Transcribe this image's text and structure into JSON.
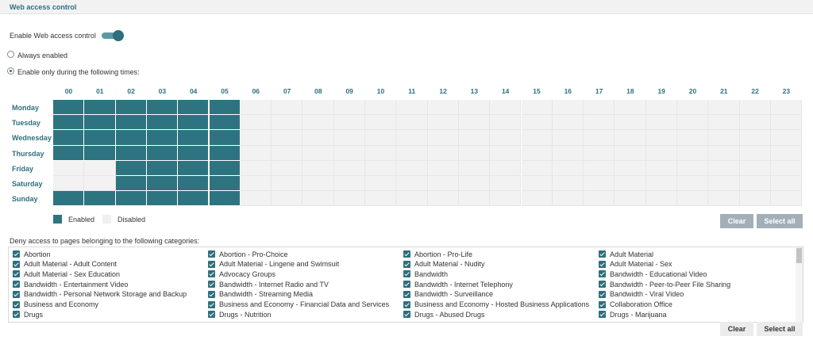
{
  "panel": {
    "title": "Web access control"
  },
  "enable": {
    "label": "Enable Web access control",
    "on": true
  },
  "schedule_mode": {
    "always_label": "Always enabled",
    "times_label": "Enable only during the following times:",
    "selected": "times"
  },
  "schedule": {
    "hours": [
      "00",
      "01",
      "02",
      "03",
      "04",
      "05",
      "06",
      "07",
      "08",
      "09",
      "10",
      "11",
      "12",
      "13",
      "14",
      "15",
      "16",
      "17",
      "18",
      "19",
      "20",
      "21",
      "22",
      "23"
    ],
    "days": [
      {
        "label": "Monday",
        "enabled_hours": [
          0,
          1,
          2,
          3,
          4,
          5
        ]
      },
      {
        "label": "Tuesday",
        "enabled_hours": [
          0,
          1,
          2,
          3,
          4,
          5
        ]
      },
      {
        "label": "Wednesday",
        "enabled_hours": [
          0,
          1,
          2,
          3,
          4,
          5
        ]
      },
      {
        "label": "Thursday",
        "enabled_hours": [
          0,
          1,
          2,
          3,
          4,
          5
        ]
      },
      {
        "label": "Friday",
        "enabled_hours": [
          2,
          3,
          4,
          5
        ]
      },
      {
        "label": "Saturday",
        "enabled_hours": [
          2,
          3,
          4,
          5
        ]
      },
      {
        "label": "Sunday",
        "enabled_hours": [
          0,
          1,
          2,
          3,
          4,
          5
        ]
      }
    ],
    "legend": {
      "enabled": "Enabled",
      "disabled": "Disabled"
    },
    "clear_label": "Clear",
    "select_all_label": "Select all"
  },
  "categories": {
    "heading": "Deny access to pages belonging to the following categories:",
    "columns": [
      [
        "Abortion",
        "Adult Material - Adult Content",
        "Adult Material - Sex Education",
        "Bandwidth - Entertainment Video",
        "Bandwidth - Personal Network Storage and Backup",
        "Business and Economy",
        "Drugs"
      ],
      [
        "Abortion - Pro-Choice",
        "Adult Material - Lingerie and Swimsuit",
        "Advocacy Groups",
        "Bandwidth - Internet Radio and TV",
        "Bandwidth - Streaming Media",
        "Business and Economy - Financial Data and Services",
        "Drugs - Nutrition"
      ],
      [
        "Abortion - Pro-Life",
        "Adult Material - Nudity",
        "Bandwidth",
        "Bandwidth - Internet Telephony",
        "Bandwidth - Surveillance",
        "Business and Economy - Hosted Business Applications",
        "Drugs - Abused Drugs"
      ],
      [
        "Adult Material",
        "Adult Material - Sex",
        "Bandwidth - Educational Video",
        "Bandwidth - Peer-to-Peer File Sharing",
        "Bandwidth - Viral Video",
        "Collaboration Office",
        "Drugs - Marijuana"
      ]
    ],
    "clear_label": "Clear",
    "select_all_label": "Select all"
  },
  "colors": {
    "accent": "#2e6f7c",
    "enabled_cell": "#2e7480",
    "disabled_cell": "#f2f2f2"
  }
}
